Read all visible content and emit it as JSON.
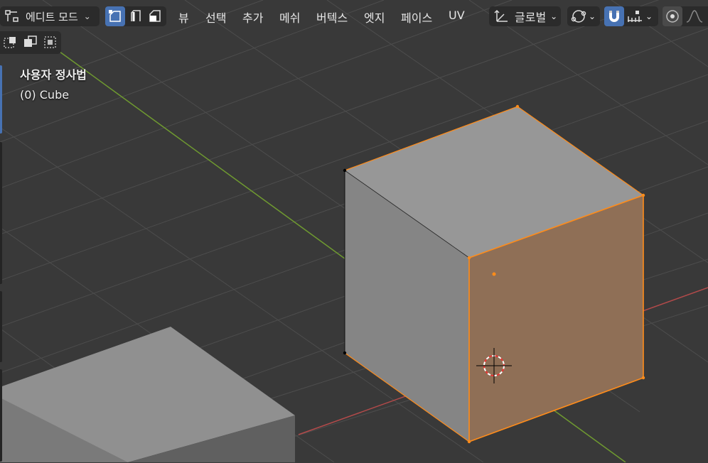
{
  "header": {
    "mode_label": "에디트 모드",
    "menu": [
      "뷰",
      "선택",
      "추가",
      "메쉬",
      "버텍스",
      "엣지",
      "페이스",
      "UV"
    ],
    "orientation_label": "글로벌"
  },
  "overlay": {
    "view_name": "사용자 정사법",
    "object_info": "(0) Cube"
  },
  "colors": {
    "accent": "#4772b3",
    "selection": "#ff8c1a",
    "selected_face": "#8f6f56",
    "x_axis": "#b24a4a",
    "y_axis": "#6f9a30",
    "grid": "#4a4a4a",
    "background": "#393939"
  }
}
